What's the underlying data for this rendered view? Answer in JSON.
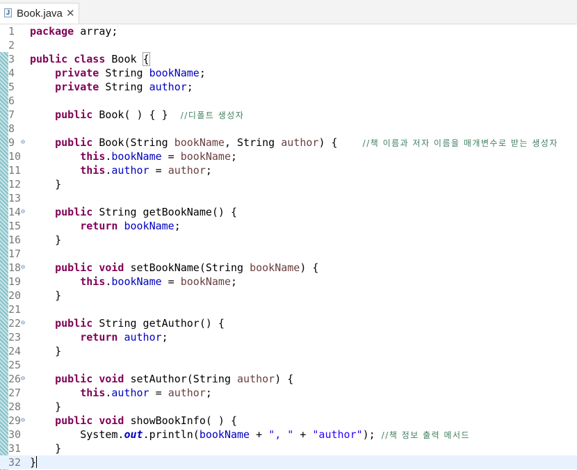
{
  "tab": {
    "icon_letter": "J",
    "title": "Book.java",
    "close_glyph": "✕"
  },
  "code": {
    "lines": [
      {
        "n": "1",
        "fold": "",
        "tokens": [
          [
            "kw",
            "package"
          ],
          [
            "t",
            " array;"
          ]
        ]
      },
      {
        "n": "2",
        "fold": "",
        "tokens": []
      },
      {
        "n": "3",
        "fold": "",
        "tokens": [
          [
            "kw",
            "public"
          ],
          [
            "t",
            " "
          ],
          [
            "kw",
            "class"
          ],
          [
            "t",
            " Book "
          ],
          [
            "box",
            "{"
          ]
        ]
      },
      {
        "n": "4",
        "fold": "",
        "tokens": [
          [
            "t",
            "    "
          ],
          [
            "kw",
            "private"
          ],
          [
            "t",
            " String "
          ],
          [
            "fld",
            "bookName"
          ],
          [
            "t",
            ";"
          ]
        ]
      },
      {
        "n": "5",
        "fold": "",
        "tokens": [
          [
            "t",
            "    "
          ],
          [
            "kw",
            "private"
          ],
          [
            "t",
            " String "
          ],
          [
            "fld",
            "author"
          ],
          [
            "t",
            ";"
          ]
        ]
      },
      {
        "n": "6",
        "fold": "",
        "tokens": []
      },
      {
        "n": "7",
        "fold": "",
        "tokens": [
          [
            "t",
            "    "
          ],
          [
            "kw",
            "public"
          ],
          [
            "t",
            " Book( ) { }  "
          ],
          [
            "cmt",
            "//디폴트 생성자"
          ]
        ]
      },
      {
        "n": "8",
        "fold": "",
        "tokens": []
      },
      {
        "n": "9",
        "fold": "⊖",
        "tokens": [
          [
            "t",
            "    "
          ],
          [
            "kw",
            "public"
          ],
          [
            "t",
            " Book(String "
          ],
          [
            "param",
            "bookName"
          ],
          [
            "t",
            ", String "
          ],
          [
            "param",
            "author"
          ],
          [
            "t",
            ") {    "
          ],
          [
            "cmt",
            "//책 이름과 저자 이름을 매개변수로 받는 생성자"
          ]
        ]
      },
      {
        "n": "10",
        "fold": "",
        "tokens": [
          [
            "t",
            "        "
          ],
          [
            "kw",
            "this"
          ],
          [
            "t",
            "."
          ],
          [
            "fld",
            "bookName"
          ],
          [
            "t",
            " = "
          ],
          [
            "param",
            "bookName"
          ],
          [
            "t",
            ";"
          ]
        ]
      },
      {
        "n": "11",
        "fold": "",
        "tokens": [
          [
            "t",
            "        "
          ],
          [
            "kw",
            "this"
          ],
          [
            "t",
            "."
          ],
          [
            "fld",
            "author"
          ],
          [
            "t",
            " = "
          ],
          [
            "param",
            "author"
          ],
          [
            "t",
            ";"
          ]
        ]
      },
      {
        "n": "12",
        "fold": "",
        "tokens": [
          [
            "t",
            "    }"
          ]
        ]
      },
      {
        "n": "13",
        "fold": "",
        "tokens": []
      },
      {
        "n": "14",
        "fold": "⊖",
        "tokens": [
          [
            "t",
            "    "
          ],
          [
            "kw",
            "public"
          ],
          [
            "t",
            " String getBookName() {"
          ]
        ]
      },
      {
        "n": "15",
        "fold": "",
        "tokens": [
          [
            "t",
            "        "
          ],
          [
            "kw",
            "return"
          ],
          [
            "t",
            " "
          ],
          [
            "fld",
            "bookName"
          ],
          [
            "t",
            ";"
          ]
        ]
      },
      {
        "n": "16",
        "fold": "",
        "tokens": [
          [
            "t",
            "    }"
          ]
        ]
      },
      {
        "n": "17",
        "fold": "",
        "tokens": []
      },
      {
        "n": "18",
        "fold": "⊖",
        "tokens": [
          [
            "t",
            "    "
          ],
          [
            "kw",
            "public"
          ],
          [
            "t",
            " "
          ],
          [
            "kw",
            "void"
          ],
          [
            "t",
            " setBookName(String "
          ],
          [
            "param",
            "bookName"
          ],
          [
            "t",
            ") {"
          ]
        ]
      },
      {
        "n": "19",
        "fold": "",
        "tokens": [
          [
            "t",
            "        "
          ],
          [
            "kw",
            "this"
          ],
          [
            "t",
            "."
          ],
          [
            "fld",
            "bookName"
          ],
          [
            "t",
            " = "
          ],
          [
            "param",
            "bookName"
          ],
          [
            "t",
            ";"
          ]
        ]
      },
      {
        "n": "20",
        "fold": "",
        "tokens": [
          [
            "t",
            "    }"
          ]
        ]
      },
      {
        "n": "21",
        "fold": "",
        "tokens": []
      },
      {
        "n": "22",
        "fold": "⊖",
        "tokens": [
          [
            "t",
            "    "
          ],
          [
            "kw",
            "public"
          ],
          [
            "t",
            " String getAuthor() {"
          ]
        ]
      },
      {
        "n": "23",
        "fold": "",
        "tokens": [
          [
            "t",
            "        "
          ],
          [
            "kw",
            "return"
          ],
          [
            "t",
            " "
          ],
          [
            "fld",
            "author"
          ],
          [
            "t",
            ";"
          ]
        ]
      },
      {
        "n": "24",
        "fold": "",
        "tokens": [
          [
            "t",
            "    }"
          ]
        ]
      },
      {
        "n": "25",
        "fold": "",
        "tokens": []
      },
      {
        "n": "26",
        "fold": "⊖",
        "tokens": [
          [
            "t",
            "    "
          ],
          [
            "kw",
            "public"
          ],
          [
            "t",
            " "
          ],
          [
            "kw",
            "void"
          ],
          [
            "t",
            " setAuthor(String "
          ],
          [
            "param",
            "author"
          ],
          [
            "t",
            ") {"
          ]
        ]
      },
      {
        "n": "27",
        "fold": "",
        "tokens": [
          [
            "t",
            "        "
          ],
          [
            "kw",
            "this"
          ],
          [
            "t",
            "."
          ],
          [
            "fld",
            "author"
          ],
          [
            "t",
            " = "
          ],
          [
            "param",
            "author"
          ],
          [
            "t",
            ";"
          ]
        ]
      },
      {
        "n": "28",
        "fold": "",
        "tokens": [
          [
            "t",
            "    }"
          ]
        ]
      },
      {
        "n": "29",
        "fold": "⊖",
        "tokens": [
          [
            "t",
            "    "
          ],
          [
            "kw",
            "public"
          ],
          [
            "t",
            " "
          ],
          [
            "kw",
            "void"
          ],
          [
            "t",
            " showBookInfo( ) {"
          ]
        ]
      },
      {
        "n": "30",
        "fold": "",
        "tokens": [
          [
            "t",
            "        System."
          ],
          [
            "static",
            "out"
          ],
          [
            "t",
            ".println("
          ],
          [
            "fld",
            "bookName"
          ],
          [
            "t",
            " + "
          ],
          [
            "str",
            "\", \""
          ],
          [
            "t",
            " + "
          ],
          [
            "str",
            "\"author\""
          ],
          [
            "t",
            "); "
          ],
          [
            "cmt",
            "//책 정보 출력 메서드"
          ]
        ]
      },
      {
        "n": "31",
        "fold": "",
        "tokens": [
          [
            "t",
            "    }"
          ]
        ]
      },
      {
        "n": "32",
        "fold": "",
        "tokens": [
          [
            "t",
            "}"
          ],
          [
            "caret",
            ""
          ]
        ],
        "current": true
      }
    ]
  },
  "colors": {
    "keyword": "#7f0055",
    "field": "#0000c0",
    "parameter": "#6a3e3e",
    "comment": "#3f7f5f",
    "string": "#2a00ff",
    "current_line": "#e8f2fe"
  }
}
